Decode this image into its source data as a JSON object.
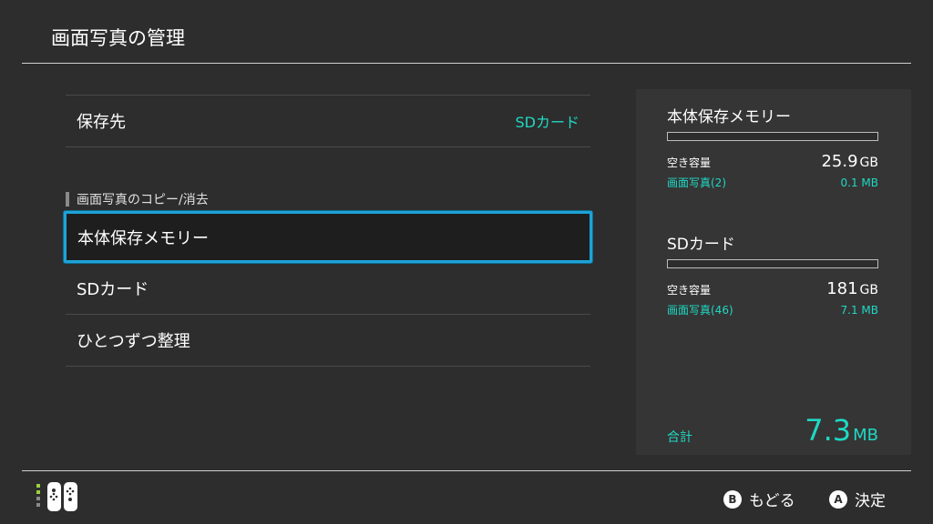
{
  "header": {
    "title": "画面写真の管理"
  },
  "settings": {
    "save_location": {
      "label": "保存先",
      "value": "SDカード"
    }
  },
  "copy_section": {
    "title": "画面写真のコピー/消去",
    "items": [
      {
        "label": "本体保存メモリー",
        "selected": true
      },
      {
        "label": "SDカード",
        "selected": false
      },
      {
        "label": "ひとつずつ整理",
        "selected": false
      }
    ]
  },
  "storage": {
    "system": {
      "title": "本体保存メモリー",
      "free_label": "空き容量",
      "free_value": "25.9",
      "free_unit": "GB",
      "screens_label": "画面写真(2)",
      "screens_size": "0.1 MB"
    },
    "sd": {
      "title": "SDカード",
      "free_label": "空き容量",
      "free_value": "181",
      "free_unit": "GB",
      "screens_label": "画面写真(46)",
      "screens_size": "7.1 MB"
    },
    "total": {
      "label": "合計",
      "value": "7.3",
      "unit": "MB"
    }
  },
  "footer": {
    "controller_icon": "joycon-icon",
    "back": {
      "button": "B",
      "label": "もどる"
    },
    "ok": {
      "button": "A",
      "label": "決定"
    }
  },
  "colors": {
    "accent": "#1fd8c4",
    "selection": "#1ea3d6",
    "background": "#2d2d2d"
  }
}
